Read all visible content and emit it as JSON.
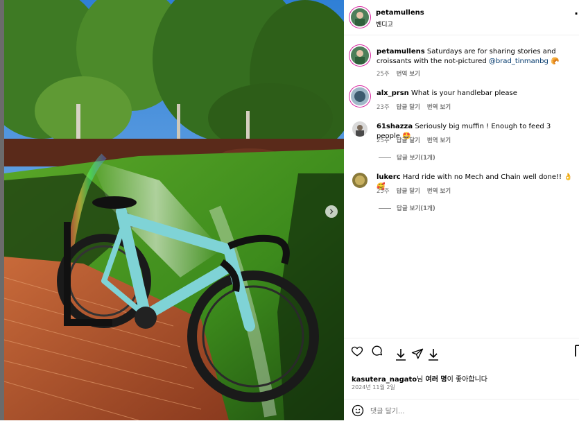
{
  "post": {
    "author": "petamullens",
    "location": "벤디고"
  },
  "caption": {
    "username": "petamullens",
    "text": "Saturdays are for sharing stories and croissants with the not-pictured",
    "mention": "@brad_tinmanbg",
    "emoji": "🥐",
    "age": "25주",
    "translate": "번역 보기"
  },
  "comments": [
    {
      "username": "alx_prsn",
      "text": "What is your handlebar please",
      "age": "23주",
      "reply": "답글 달기",
      "translate": "번역 보기",
      "replies": ""
    },
    {
      "username": "61shazza",
      "text": "Seriously big muffin ! Enough to feed 3 people 🤩",
      "age": "25주",
      "reply": "답글 달기",
      "translate": "번역 보기",
      "replies": "답글 보기(1개)"
    },
    {
      "username": "lukerc",
      "text": "Hard ride with no Mech and Chain well done!! 👌 🥰",
      "age": "25주",
      "reply": "답글 달기",
      "translate": "번역 보기",
      "replies": "답글 보기(1개)"
    }
  ],
  "likes": {
    "user": "kasutera_nagato",
    "suffix1": "님 ",
    "others": "여러 명",
    "suffix2": "이 좋아합니다"
  },
  "date": "2024년 11월 2일",
  "comment_box": {
    "placeholder": "댓글 달기..."
  },
  "more_glyph": "·",
  "colors": {
    "bike": "#7fd3d6",
    "grass": "#3f8a1f",
    "brick": "#b5562c",
    "sky": "#4a90d9",
    "link": "#00376b"
  }
}
